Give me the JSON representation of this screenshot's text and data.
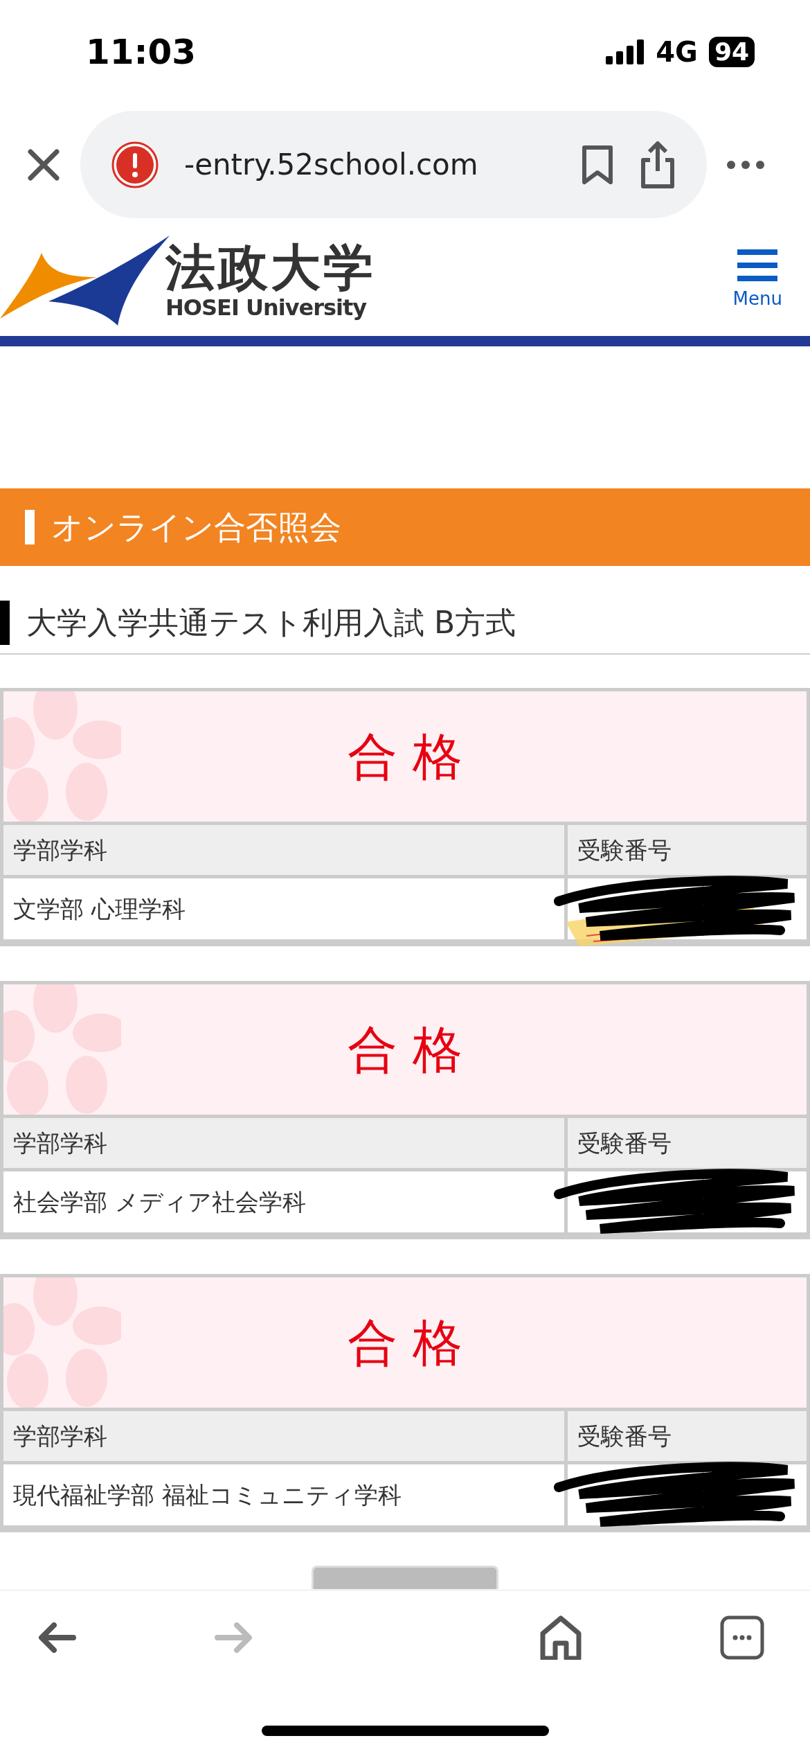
{
  "status_bar": {
    "time": "11:03",
    "network": "4G",
    "battery": "94"
  },
  "browser": {
    "url": "-entry.52school.com"
  },
  "site_header": {
    "logo_kanji": "法政大学",
    "logo_latin": "HOSEI University",
    "menu_label": "Menu"
  },
  "banner": "オンライン合否照会",
  "heading": "大学入学共通テスト利用入試 B方式",
  "results": [
    {
      "status": "合 格",
      "columns": [
        "学部学科",
        "受験番号"
      ],
      "department": "文学部 心理学科"
    },
    {
      "status": "合 格",
      "columns": [
        "学部学科",
        "受験番号"
      ],
      "department": "社会学部 メディア社会学科"
    },
    {
      "status": "合 格",
      "columns": [
        "学部学科",
        "受験番号"
      ],
      "department": "現代福祉学部 福祉コミュニティ学科"
    }
  ]
}
